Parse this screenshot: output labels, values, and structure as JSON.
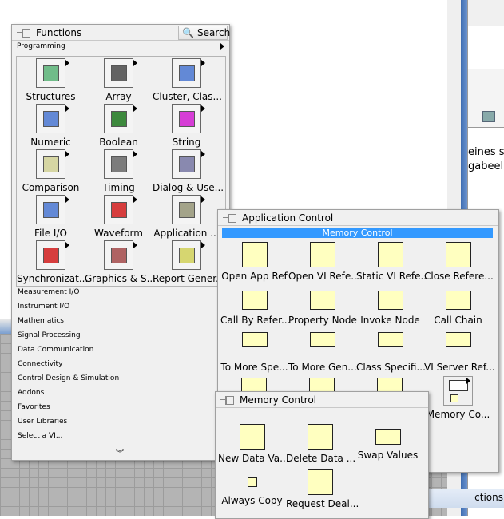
{
  "functions_palette": {
    "title": "Functions",
    "search_label": "Search",
    "category": "Programming",
    "items": [
      "Structures",
      "Array",
      "Cluster, Clas...",
      "Numeric",
      "Boolean",
      "String",
      "Comparison",
      "Timing",
      "Dialog & Use...",
      "File I/O",
      "Waveform",
      "Application ...",
      "Synchronizat...",
      "Graphics & S...",
      "Report Gener..."
    ],
    "categories": [
      "Measurement I/O",
      "Instrument I/O",
      "Mathematics",
      "Signal Processing",
      "Data Communication",
      "Connectivity",
      "Control Design & Simulation",
      "Addons",
      "Favorites",
      "User Libraries",
      "Select a VI..."
    ],
    "more_icon": "double-chevron-down-icon"
  },
  "app_control_palette": {
    "title": "Application Control",
    "highlight": "Memory Control",
    "items": [
      "Open App Ref",
      "Open VI Refe...",
      "Static VI Refe...",
      "Close Refere...",
      "Call By Refer...",
      "Property Node",
      "Invoke Node",
      "Call Chain",
      "To More Spe...",
      "To More Gen...",
      "Class Specifi...",
      "VI Server Ref..."
    ],
    "memory_item": "Memory Co..."
  },
  "memory_palette": {
    "title": "Memory Control",
    "items": [
      "New Data Va...",
      "Delete Data ...",
      "Swap Values",
      "Always Copy",
      "Request Deal..."
    ]
  },
  "background": {
    "text1": "eines s",
    "text2": "gabeel",
    "tab": "ctions"
  },
  "colors": {
    "highlight": "#3399ff",
    "icon_bg": "#ffffc0"
  }
}
